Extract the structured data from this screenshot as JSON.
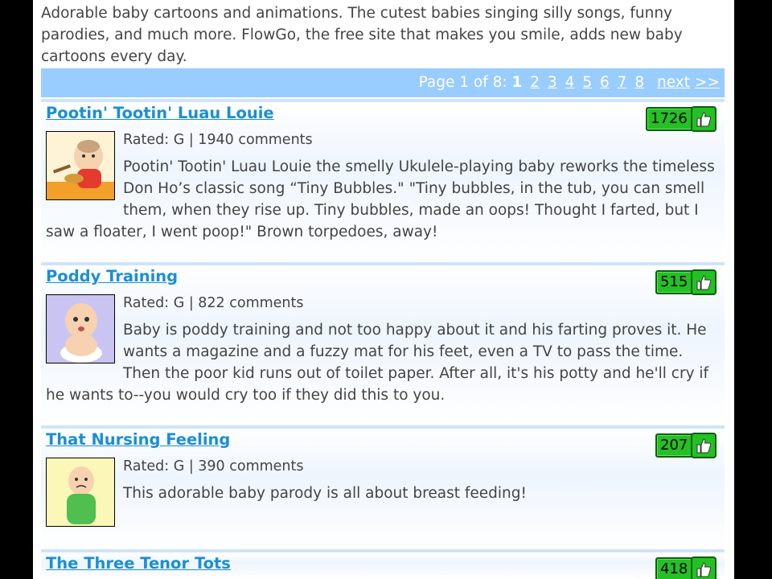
{
  "intro": {
    "text": "Adorable baby cartoons and animations. The cutest babies singing silly songs, funny parodies, and much more. FlowGo, the free site that makes you smile, adds new baby cartoons every day."
  },
  "pager": {
    "prefix": "Page 1 of 8: ",
    "current": "1",
    "pages": [
      "2",
      "3",
      "4",
      "5",
      "6",
      "7",
      "8"
    ],
    "next_label": "next",
    "arrows_label": ">>"
  },
  "items": [
    {
      "title": "Pootin' Tootin' Luau Louie",
      "meta": "Rated: G | 1940 comments",
      "votes": "1726",
      "description": "Pootin' Tootin' Luau Louie the smelly Ukulele-playing baby reworks the timeless Don Ho’s classic song “Tiny Bubbles.\" \"Tiny bubbles, in the tub, you can smell them, when they rise up. Tiny bubbles, made an oops! Thought I farted, but I saw a floater, I went poop!\" Brown torpedoes, away!"
    },
    {
      "title": "Poddy Training",
      "meta": "Rated: G | 822 comments",
      "votes": "515",
      "description": "Baby is poddy training and not too happy about it and his farting proves it. He wants a magazine and a fuzzy mat for his feet, even a TV to pass the time. Then the poor kid runs out of toilet paper. After all, it's his potty and he'll cry if he wants to--you would cry too if they did this to you."
    },
    {
      "title": "That Nursing Feeling",
      "meta": "Rated: G | 390 comments",
      "votes": "207",
      "description": "This adorable baby parody is all about breast feeding!"
    },
    {
      "title": "The Three Tenor Tots",
      "votes": "418"
    }
  ],
  "icons": {
    "vote": "thumbs-up-icon"
  },
  "colors": {
    "pager_bg": "#99ccff",
    "link": "#1a8fd6",
    "vote_green": "#23c123"
  }
}
